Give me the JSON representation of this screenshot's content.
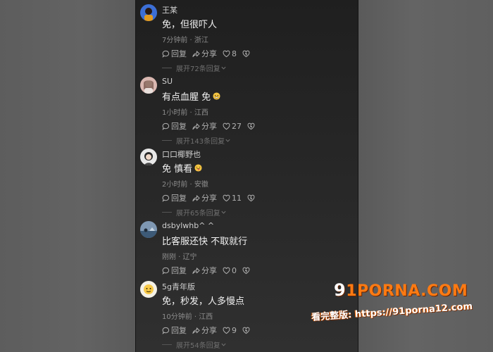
{
  "comments": [
    {
      "username": "王某",
      "text": "免，但很吓人",
      "meta": "7分钟前 · 浙江",
      "reply_label": "回复",
      "share_label": "分享",
      "likes": "8",
      "expand": "展开72条回复"
    },
    {
      "username": "SU",
      "text": "有点血腥 免",
      "meta": "1小时前 · 江西",
      "reply_label": "回复",
      "share_label": "分享",
      "likes": "27",
      "expand": "展开143条回复"
    },
    {
      "username": "口口椰野也",
      "text": "免 慎看",
      "meta": "2小时前 · 安徽",
      "reply_label": "回复",
      "share_label": "分享",
      "likes": "11",
      "expand": "展开65条回复"
    },
    {
      "username": "dsbylwhb^ ^",
      "text": "比客服还快 不取就行",
      "meta": "刚刚 · 辽宁",
      "reply_label": "回复",
      "share_label": "分享",
      "likes": "0",
      "expand": ""
    },
    {
      "username": "5g青年版",
      "text": "免，秒发，人多慢点",
      "meta": "10分钟前 · 江西",
      "reply_label": "回复",
      "share_label": "分享",
      "likes": "9",
      "expand": "展开54条回复"
    }
  ],
  "watermark": {
    "logo_prefix": "9",
    "logo_text": "1PORNA.COM",
    "url_text": "看完整版: https://91porna12.com"
  },
  "colors": {
    "watermark_orange": "#ff7a12",
    "feed_bg": "#242424"
  },
  "icons": [
    "reply-icon",
    "share-icon",
    "heart-icon",
    "dislike-icon",
    "chevron-down-icon"
  ]
}
